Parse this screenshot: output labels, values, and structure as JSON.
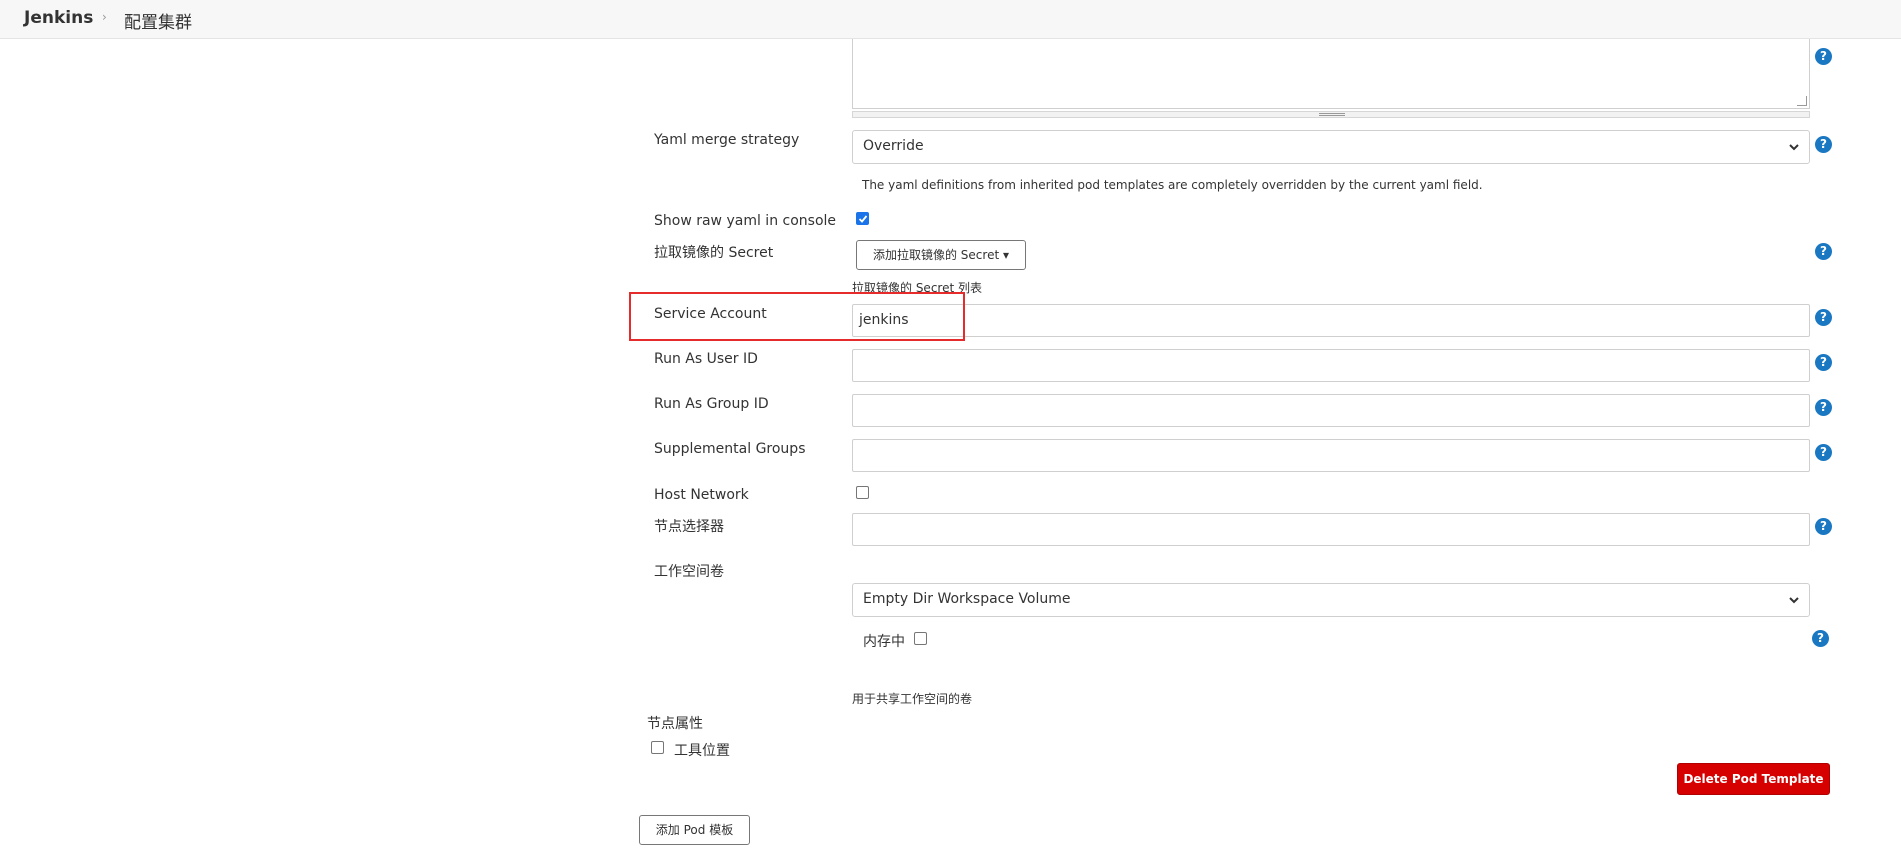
{
  "breadcrumb": {
    "home": "Jenkins",
    "separator": "›",
    "current": "配置集群"
  },
  "yaml_merge": {
    "label": "Yaml merge strategy",
    "selected": "Override",
    "description": "The yaml definitions from inherited pod templates are completely overridden by the current yaml field."
  },
  "show_raw_yaml": {
    "label": "Show raw yaml in console",
    "checked": true
  },
  "pull_secret": {
    "label": "拉取镜像的 Secret",
    "button": "添加拉取镜像的 Secret ▾",
    "description": "拉取镜像的 Secret 列表"
  },
  "service_account": {
    "label": "Service Account",
    "value": "jenkins"
  },
  "run_as_user": {
    "label": "Run As User ID",
    "value": ""
  },
  "run_as_group": {
    "label": "Run As Group ID",
    "value": ""
  },
  "supplemental_groups": {
    "label": "Supplemental Groups",
    "value": ""
  },
  "host_network": {
    "label": "Host Network",
    "checked": false
  },
  "node_selector": {
    "label": "节点选择器",
    "value": ""
  },
  "workspace_volume": {
    "label": "工作空间卷",
    "selected": "Empty Dir Workspace Volume",
    "in_memory_label": "内存中",
    "in_memory_checked": false,
    "description": "用于共享工作空间的卷"
  },
  "node_properties": {
    "label": "节点属性",
    "tool_location": "工具位置",
    "tool_location_checked": false
  },
  "buttons": {
    "delete_pod_template": "Delete Pod Template",
    "add_pod_template": "添加 Pod 模板"
  },
  "help_symbol": "?",
  "colors": {
    "help": "#1a78c2",
    "danger": "#d70000",
    "highlight": "#e52b2b"
  }
}
